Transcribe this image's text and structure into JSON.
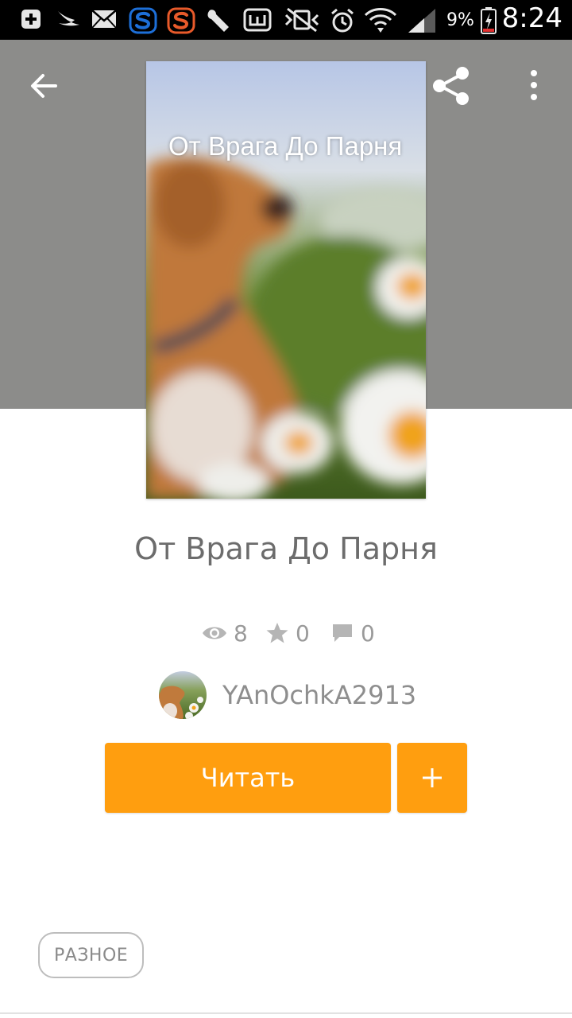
{
  "status_bar": {
    "battery_percent": "9%",
    "time": "8:24",
    "icons": [
      "add-notification-icon",
      "swift-icon",
      "mail-icon",
      "s-app-blue-icon",
      "s-app-orange-icon",
      "wrench-icon",
      "w-app-icon",
      "mute-vibrate-icon",
      "alarm-icon",
      "wifi-icon",
      "signal-icon",
      "battery-charging-icon"
    ]
  },
  "toolbar": {
    "back_icon": "arrow-left-icon",
    "share_icon": "share-icon",
    "more_icon": "more-vertical-icon"
  },
  "cover": {
    "title": "От Врага До Парня",
    "image": "blurred-dog-with-daisies"
  },
  "story": {
    "title": "От Врага До Парня",
    "views": "8",
    "votes": "0",
    "comments": "0"
  },
  "author": {
    "name": "YAnOchkA2913"
  },
  "actions": {
    "read_label": "Читать",
    "add_label": "+"
  },
  "tags": [
    "РАЗНОЕ"
  ],
  "colors": {
    "accent": "#ff9e0f",
    "header_bg": "#8c8c8a",
    "text_muted": "#9a9a9a"
  }
}
